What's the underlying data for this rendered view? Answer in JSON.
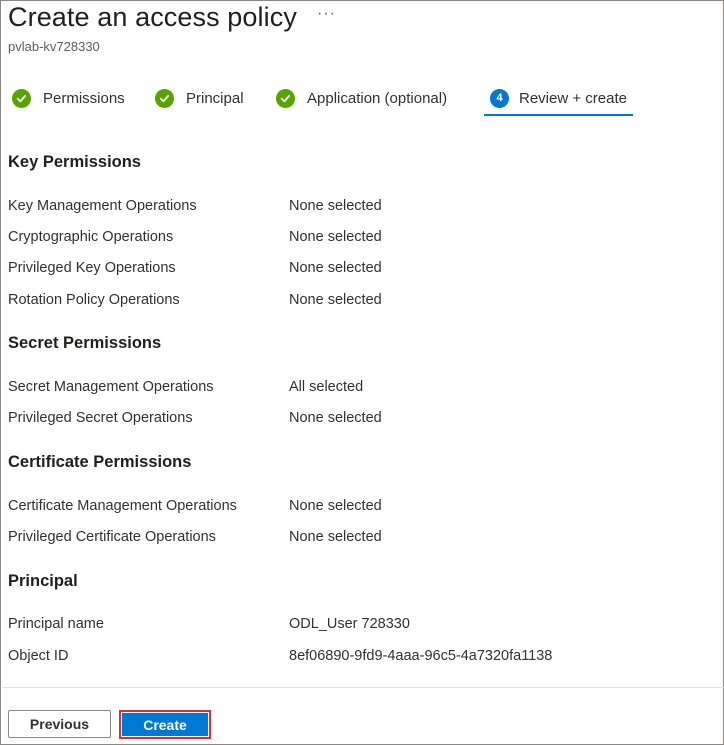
{
  "header": {
    "title": "Create an access policy",
    "more_label": "···",
    "subtitle": "pvlab-kv728330"
  },
  "steps": [
    {
      "label": "Permissions",
      "state": "complete",
      "icon": "check-circle-icon"
    },
    {
      "label": "Principal",
      "state": "complete",
      "icon": "check-circle-icon"
    },
    {
      "label": "Application (optional)",
      "state": "complete",
      "icon": "check-circle-icon"
    },
    {
      "label": "Review + create",
      "state": "active",
      "number": "4"
    }
  ],
  "sections": {
    "key": {
      "heading": "Key Permissions",
      "rows": [
        {
          "label": "Key Management Operations",
          "value": "None selected"
        },
        {
          "label": "Cryptographic Operations",
          "value": "None selected"
        },
        {
          "label": "Privileged Key Operations",
          "value": "None selected"
        },
        {
          "label": "Rotation Policy Operations",
          "value": "None selected"
        }
      ]
    },
    "secret": {
      "heading": "Secret Permissions",
      "rows": [
        {
          "label": "Secret Management Operations",
          "value": "All selected"
        },
        {
          "label": "Privileged Secret Operations",
          "value": "None selected"
        }
      ]
    },
    "certificate": {
      "heading": "Certificate Permissions",
      "rows": [
        {
          "label": "Certificate Management Operations",
          "value": "None selected"
        },
        {
          "label": "Privileged Certificate Operations",
          "value": "None selected"
        }
      ]
    },
    "principal": {
      "heading": "Principal",
      "rows": [
        {
          "label": "Principal name",
          "value": "ODL_User 728330"
        },
        {
          "label": "Object ID",
          "value": "8ef06890-9fd9-4aaa-96c5-4a7320fa1138"
        }
      ]
    }
  },
  "footer": {
    "previous_label": "Previous",
    "create_label": "Create"
  },
  "colors": {
    "accent": "#0078d4",
    "success": "#57a300",
    "highlight_border": "#d13438"
  }
}
